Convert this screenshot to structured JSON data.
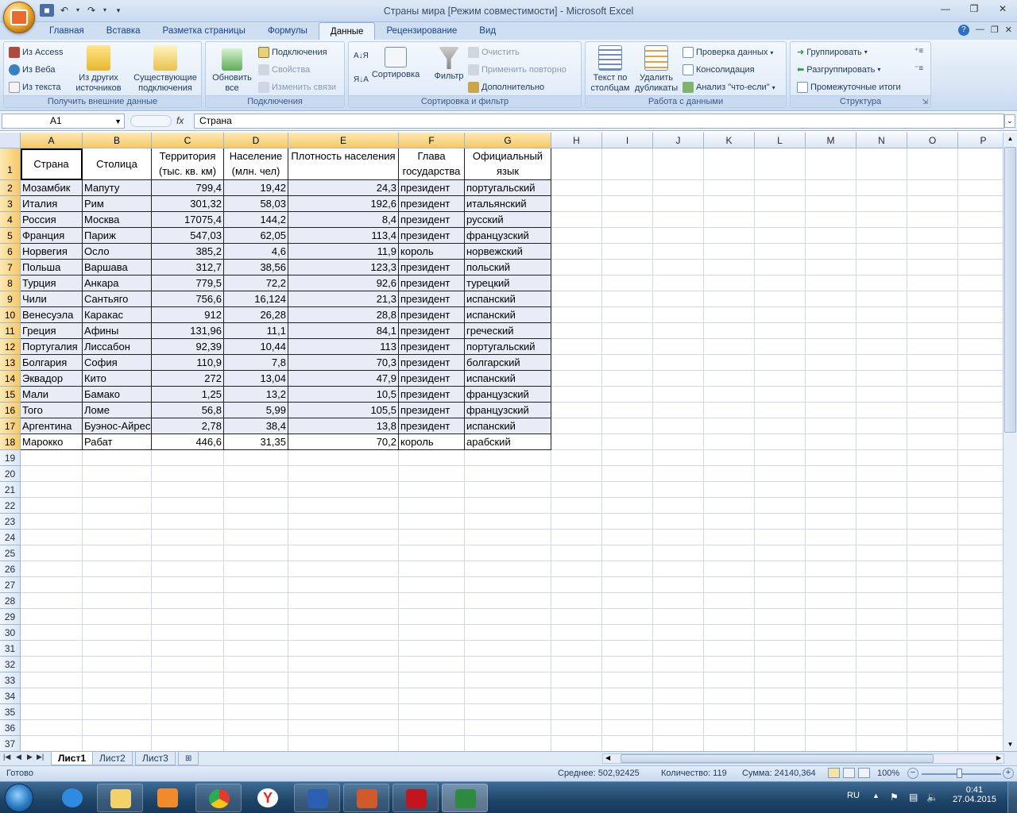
{
  "window": {
    "title": "Страны мира  [Режим совместимости] - Microsoft Excel"
  },
  "tabs": [
    "Главная",
    "Вставка",
    "Разметка страницы",
    "Формулы",
    "Данные",
    "Рецензирование",
    "Вид"
  ],
  "active_tab": "Данные",
  "ribbon": {
    "external": {
      "label": "Получить внешние данные",
      "access": "Из Access",
      "web": "Из Веба",
      "text": "Из текста",
      "other_line1": "Из других",
      "other_line2": "источников",
      "existing_line1": "Существующие",
      "existing_line2": "подключения"
    },
    "connections": {
      "label": "Подключения",
      "refresh_line1": "Обновить",
      "refresh_line2": "все",
      "connections": "Подключения",
      "properties": "Свойства",
      "edit_links": "Изменить связи"
    },
    "sort": {
      "label": "Сортировка и фильтр",
      "sort": "Сортировка",
      "filter": "Фильтр",
      "clear": "Очистить",
      "reapply": "Применить повторно",
      "advanced": "Дополнительно"
    },
    "tools": {
      "label": "Работа с данными",
      "text_cols_line1": "Текст по",
      "text_cols_line2": "столбцам",
      "dupes_line1": "Удалить",
      "dupes_line2": "дубликаты",
      "validation": "Проверка данных",
      "consolidate": "Консолидация",
      "whatif": "Анализ \"что-если\""
    },
    "outline": {
      "label": "Структура",
      "group": "Группировать",
      "ungroup": "Разгруппировать",
      "subtotal": "Промежуточные итоги"
    }
  },
  "formula_bar": {
    "name_box": "A1",
    "fx": "fx",
    "content": "Страна"
  },
  "columns": [
    "A",
    "B",
    "C",
    "D",
    "E",
    "F",
    "G",
    "H",
    "I",
    "J",
    "K",
    "L",
    "M",
    "N",
    "O",
    "P"
  ],
  "header_row": {
    "a": "Страна",
    "b": "Столица",
    "c": "Территория (тыс. кв. км)",
    "d": "Население (млн. чел)",
    "e": "Плотность населения",
    "f": "Глава государства",
    "g": "Официальный язык"
  },
  "rows": [
    [
      "Мозамбик",
      "Мапуту",
      "799,4",
      "19,42",
      "24,3",
      "президент",
      "португальский"
    ],
    [
      "Италия",
      "Рим",
      "301,32",
      "58,03",
      "192,6",
      "президент",
      "итальянский"
    ],
    [
      "Россия",
      "Москва",
      "17075,4",
      "144,2",
      "8,4",
      "президент",
      "русский"
    ],
    [
      "Франция",
      "Париж",
      "547,03",
      "62,05",
      "113,4",
      "президент",
      "французский"
    ],
    [
      "Норвегия",
      "Осло",
      "385,2",
      "4,6",
      "11,9",
      "король",
      "норвежский"
    ],
    [
      "Польша",
      "Варшава",
      "312,7",
      "38,56",
      "123,3",
      "президент",
      "польский"
    ],
    [
      "Турция",
      "Анкара",
      "779,5",
      "72,2",
      "92,6",
      "президент",
      "турецкий"
    ],
    [
      "Чили",
      "Сантьяго",
      "756,6",
      "16,124",
      "21,3",
      "президент",
      "испанский"
    ],
    [
      "Венесуэла",
      "Каракас",
      "912",
      "26,28",
      "28,8",
      "президент",
      "испанский"
    ],
    [
      "Греция",
      "Афины",
      "131,96",
      "11,1",
      "84,1",
      "президент",
      "греческий"
    ],
    [
      "Португалия",
      "Лиссабон",
      "92,39",
      "10,44",
      "113",
      "президент",
      "португальский"
    ],
    [
      "Болгария",
      "София",
      "110,9",
      "7,8",
      "70,3",
      "президент",
      "болгарский"
    ],
    [
      "Эквадор",
      "Кито",
      "272",
      "13,04",
      "47,9",
      "президент",
      "испанский"
    ],
    [
      "Мали",
      "Бамако",
      "1,25",
      "13,2",
      "10,5",
      "президент",
      "французский"
    ],
    [
      "Того",
      "Ломе",
      "56,8",
      "5,99",
      "105,5",
      "президент",
      "французский"
    ],
    [
      "Аргентина",
      "Буэнос-Айрес",
      "2,78",
      "38,4",
      "13,8",
      "президент",
      "испанский"
    ],
    [
      "Марокко",
      "Рабат",
      "446,6",
      "31,35",
      "70,2",
      "король",
      "арабский"
    ]
  ],
  "sheets": [
    "Лист1",
    "Лист2",
    "Лист3"
  ],
  "active_sheet": "Лист1",
  "status": {
    "ready": "Готово",
    "average": "Среднее: 502,92425",
    "count": "Количество: 119",
    "sum": "Сумма: 24140,364",
    "zoom": "100%"
  },
  "taskbar": {
    "lang": "RU",
    "time": "0:41",
    "date": "27.04.2015"
  }
}
